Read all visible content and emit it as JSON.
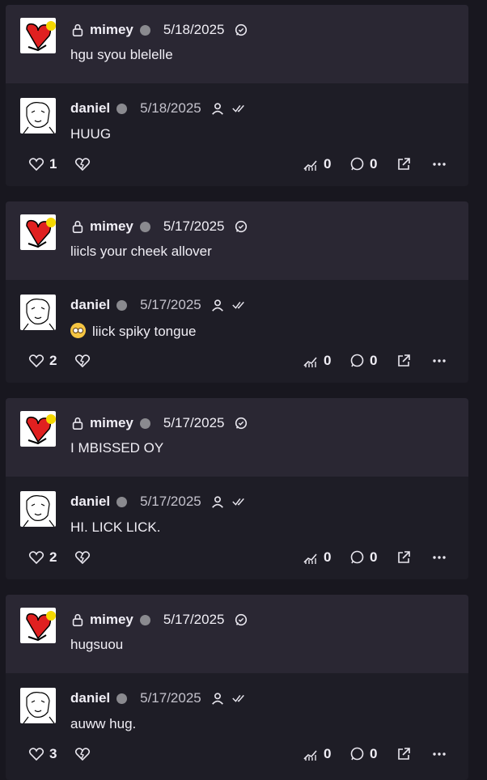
{
  "threads": [
    {
      "parent": {
        "author": "mimey",
        "date": "5/18/2025",
        "text": "hgu syou blelelle"
      },
      "reply": {
        "author": "daniel",
        "date": "5/18/2025",
        "text": "HUUG",
        "emoji": false
      },
      "stats": {
        "likes": "1",
        "views": "0",
        "comments": "0"
      }
    },
    {
      "parent": {
        "author": "mimey",
        "date": "5/17/2025",
        "text": "liicls your cheek allover"
      },
      "reply": {
        "author": "daniel",
        "date": "5/17/2025",
        "text": "liick spiky tongue",
        "emoji": true
      },
      "stats": {
        "likes": "2",
        "views": "0",
        "comments": "0"
      }
    },
    {
      "parent": {
        "author": "mimey",
        "date": "5/17/2025",
        "text": "I MBISSED OY"
      },
      "reply": {
        "author": "daniel",
        "date": "5/17/2025",
        "text": "HI. LICK LICK.",
        "emoji": false
      },
      "stats": {
        "likes": "2",
        "views": "0",
        "comments": "0"
      }
    },
    {
      "parent": {
        "author": "mimey",
        "date": "5/17/2025",
        "text": "hugsuou"
      },
      "reply": {
        "author": "daniel",
        "date": "5/17/2025",
        "text": "auww hug.",
        "emoji": false
      },
      "stats": {
        "likes": "3",
        "views": "0",
        "comments": "0"
      }
    }
  ],
  "colors": {
    "background": "#18171f",
    "parent_bg": "#2a2733",
    "reply_bg": "#1e1d26",
    "status_dot": "#8a8a8f"
  }
}
